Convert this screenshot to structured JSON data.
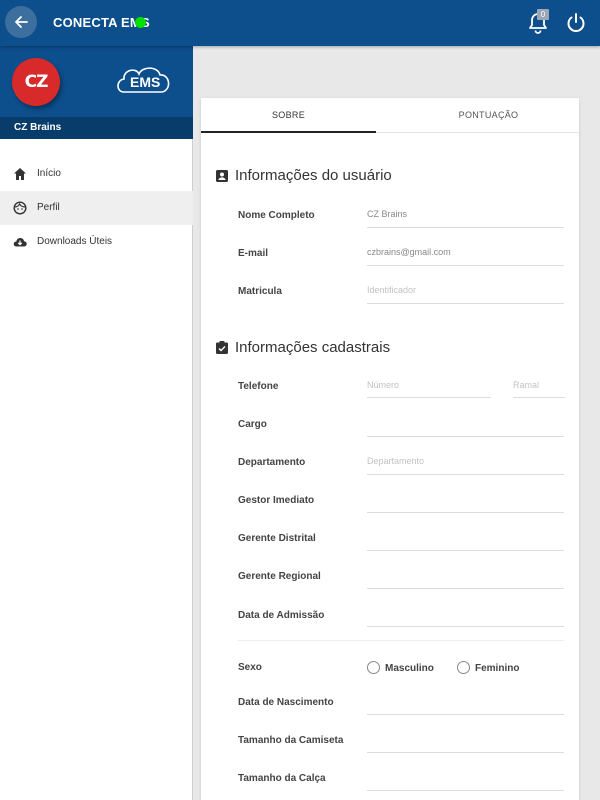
{
  "header": {
    "title": "CONECTA EMS",
    "notification_count": "0",
    "accent": "#0d4e8c",
    "status_color": "#00e000"
  },
  "sidebar": {
    "logo_left_text": "CZ",
    "logo_right_text": "EMS",
    "user_name": "CZ Brains",
    "items": [
      {
        "label": "Início",
        "icon": "home-icon"
      },
      {
        "label": "Perfil",
        "icon": "face-icon",
        "active": true
      },
      {
        "label": "Downloads Úteis",
        "icon": "cloud-download-icon"
      }
    ]
  },
  "tabs": [
    {
      "label": "SOBRE",
      "active": true
    },
    {
      "label": "PONTUAÇÃO"
    }
  ],
  "user_info": {
    "title": "Informações do usuário",
    "fields": [
      {
        "label": "Nome Completo",
        "value": "CZ Brains"
      },
      {
        "label": "E-mail",
        "value": "czbrains@gmail.com"
      },
      {
        "label": "Matricula",
        "placeholder": "Identificador"
      }
    ]
  },
  "registration": {
    "title": "Informações cadastrais",
    "phone": {
      "label": "Telefone",
      "number_placeholder": "Número",
      "ext_placeholder": "Ramal"
    },
    "fields": [
      {
        "label": "Cargo",
        "value": ""
      },
      {
        "label": "Departamento",
        "placeholder": "Departamento"
      },
      {
        "label": "Gestor Imediato",
        "value": ""
      },
      {
        "label": "Gerente Distrital",
        "value": ""
      },
      {
        "label": "Gerente Regional",
        "value": ""
      },
      {
        "label": "Data de Admissão",
        "value": ""
      }
    ],
    "sex": {
      "label": "Sexo",
      "options": [
        "Masculino",
        "Feminino"
      ]
    },
    "extra_fields": [
      {
        "label": "Data de Nascimento",
        "value": ""
      },
      {
        "label": "Tamanho da Camiseta",
        "value": ""
      },
      {
        "label": "Tamanho da Calça",
        "value": ""
      }
    ]
  }
}
